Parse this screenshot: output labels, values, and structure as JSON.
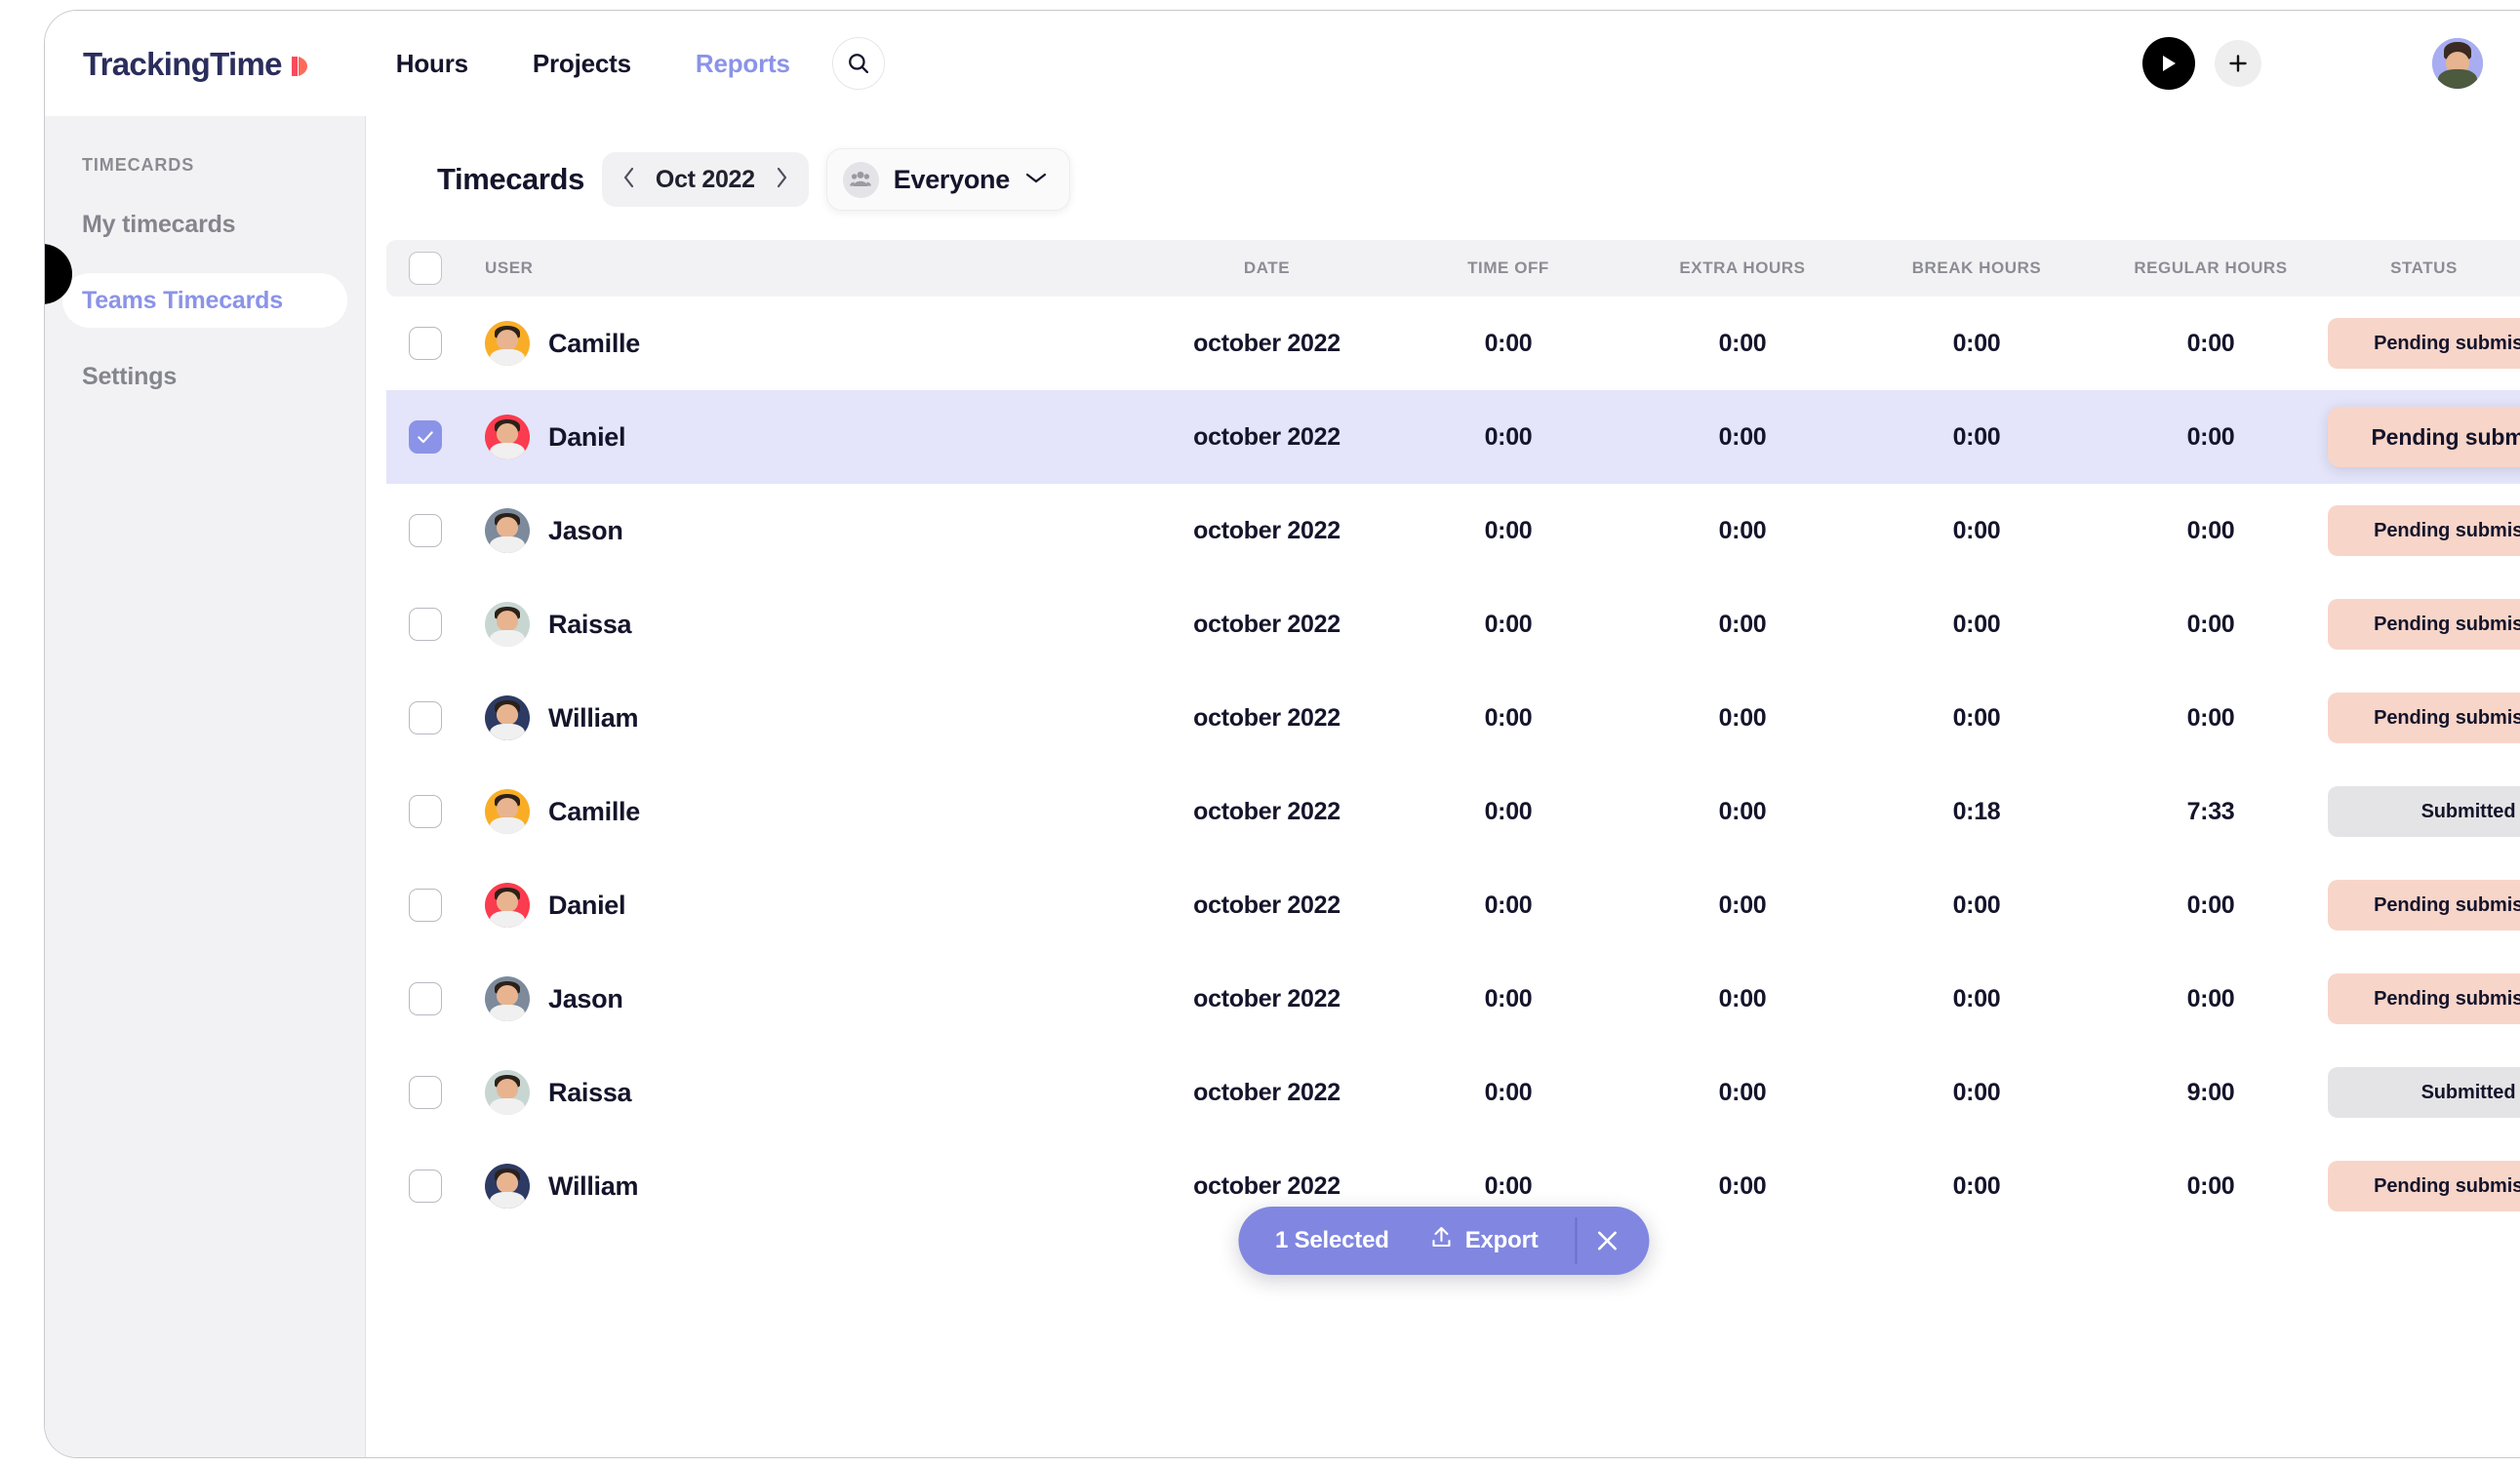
{
  "brand": {
    "logo_text": "TrackingTime",
    "logo_mark": "play-triangle-mark",
    "accent_purple": "#8b93e8",
    "accent_red": "#f9486b"
  },
  "topnav": {
    "links": [
      {
        "label": "Hours",
        "active": false
      },
      {
        "label": "Projects",
        "active": false
      },
      {
        "label": "Reports",
        "active": true
      }
    ],
    "search_icon": "search-icon",
    "play_icon": "play-icon",
    "add_icon": "plus-icon",
    "avatar": "user-avatar"
  },
  "sidebar": {
    "section_title": "TIMECARDS",
    "items": [
      {
        "label": "My timecards",
        "active": false
      },
      {
        "label": "Teams Timecards",
        "active": true
      },
      {
        "label": "Settings",
        "active": false
      }
    ],
    "collapse_knob": "sidebar-collapse-knob"
  },
  "page": {
    "title": "Timecards",
    "month": "Oct 2022",
    "prev_icon": "chevron-left-icon",
    "next_icon": "chevron-right-icon",
    "people_filter": "Everyone",
    "people_icon": "group-icon",
    "people_chevron": "chevron-down-icon"
  },
  "table": {
    "columns": [
      "USER",
      "DATE",
      "TIME OFF",
      "EXTRA HOURS",
      "BREAK HOURS",
      "REGULAR HOURS",
      "STATUS"
    ],
    "rows": [
      {
        "user": "Camille",
        "avatar_color": "#f9ad27",
        "date": "october 2022",
        "time_off": "0:00",
        "extra_hours": "0:00",
        "break_hours": "0:00",
        "regular_hours": "0:00",
        "status": "Pending submission",
        "status_kind": "pending",
        "selected": false,
        "hovered": false
      },
      {
        "user": "Daniel",
        "avatar_color": "#fb3b4f",
        "date": "october 2022",
        "time_off": "0:00",
        "extra_hours": "0:00",
        "break_hours": "0:00",
        "regular_hours": "0:00",
        "status": "Pending submission",
        "status_kind": "pending",
        "selected": true,
        "hovered": true
      },
      {
        "user": "Jason",
        "avatar_color": "#7c8a9b",
        "date": "october 2022",
        "time_off": "0:00",
        "extra_hours": "0:00",
        "break_hours": "0:00",
        "regular_hours": "0:00",
        "status": "Pending submission",
        "status_kind": "pending",
        "selected": false,
        "hovered": false
      },
      {
        "user": "Raissa",
        "avatar_color": "#c8d6d2",
        "date": "october 2022",
        "time_off": "0:00",
        "extra_hours": "0:00",
        "break_hours": "0:00",
        "regular_hours": "0:00",
        "status": "Pending submission",
        "status_kind": "pending",
        "selected": false,
        "hovered": false
      },
      {
        "user": "William",
        "avatar_color": "#2d3a63",
        "date": "october 2022",
        "time_off": "0:00",
        "extra_hours": "0:00",
        "break_hours": "0:00",
        "regular_hours": "0:00",
        "status": "Pending submission",
        "status_kind": "pending",
        "selected": false,
        "hovered": false
      },
      {
        "user": "Camille",
        "avatar_color": "#f9ad27",
        "date": "october 2022",
        "time_off": "0:00",
        "extra_hours": "0:00",
        "break_hours": "0:18",
        "regular_hours": "7:33",
        "status": "Submitted",
        "status_kind": "submitted",
        "selected": false,
        "hovered": false
      },
      {
        "user": "Daniel",
        "avatar_color": "#fb3b4f",
        "date": "october 2022",
        "time_off": "0:00",
        "extra_hours": "0:00",
        "break_hours": "0:00",
        "regular_hours": "0:00",
        "status": "Pending submission",
        "status_kind": "pending",
        "selected": false,
        "hovered": false
      },
      {
        "user": "Jason",
        "avatar_color": "#7c8a9b",
        "date": "october 2022",
        "time_off": "0:00",
        "extra_hours": "0:00",
        "break_hours": "0:00",
        "regular_hours": "0:00",
        "status": "Pending submission",
        "status_kind": "pending",
        "selected": false,
        "hovered": false
      },
      {
        "user": "Raissa",
        "avatar_color": "#c8d6d2",
        "date": "october 2022",
        "time_off": "0:00",
        "extra_hours": "0:00",
        "break_hours": "0:00",
        "regular_hours": "9:00",
        "status": "Submitted",
        "status_kind": "submitted",
        "selected": false,
        "hovered": false
      },
      {
        "user": "William",
        "avatar_color": "#2d3a63",
        "date": "october 2022",
        "time_off": "0:00",
        "extra_hours": "0:00",
        "break_hours": "0:00",
        "regular_hours": "0:00",
        "status": "Pending submission",
        "status_kind": "pending",
        "selected": false,
        "hovered": false
      }
    ]
  },
  "selection_bar": {
    "count_label": "1 Selected",
    "export_label": "Export",
    "export_icon": "upload-icon",
    "close_icon": "close-icon",
    "background": "#8187e0"
  }
}
